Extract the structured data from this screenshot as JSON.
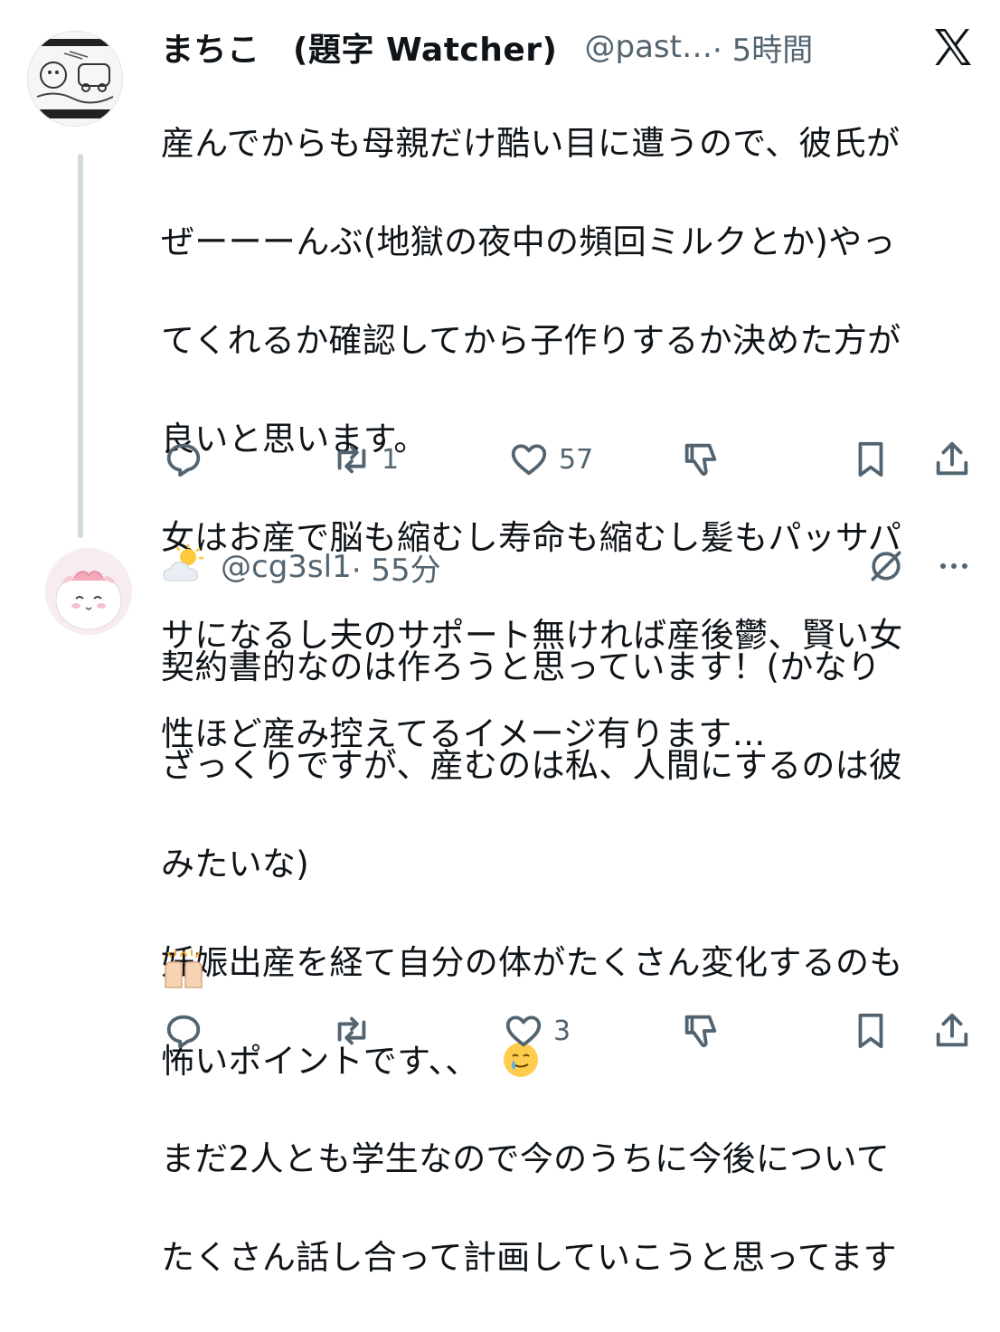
{
  "tweet1": {
    "display_name": "まちこ　(題字 Watcher)",
    "handle": "@past…",
    "time": "· 5時間",
    "body_lines": [
      "産んでからも母親だけ酷い目に遭うので、彼氏が",
      "ぜーーーんぶ(地獄の夜中の頻回ミルクとか)やっ",
      "てくれるか確認してから子作りするか決めた方が",
      "良いと思います。",
      "女はお産で脳も縮むし寿命も縮むし髪もパッサパ",
      "サになるし夫のサポート無ければ産後鬱、賢い女",
      "性ほど産み控えてるイメージ有ります…"
    ],
    "actions": {
      "retweets": "1",
      "likes": "57"
    },
    "icons": [
      "x-logo-icon",
      "reply-icon",
      "retweet-icon",
      "heart-icon",
      "dislike-icon",
      "bookmark-icon",
      "share-icon"
    ]
  },
  "tweet2": {
    "handle": "@cg3sl1",
    "time": "· 55分",
    "body_lines": [
      "契約書的なのは作ろうと思っています！(かなり",
      "ざっくりですが、産むのは私、人間にするのは彼",
      "みたいな)",
      "妊娠出産を経て自分の体がたくさん変化するのも",
      "怖いポイントです、、",
      "まだ2人とも学生なので今のうちに今後について",
      "たくさん話し合って計画していこうと思ってます"
    ],
    "actions": {
      "likes": "3"
    },
    "icons": [
      "sun-behind-cloud-icon",
      "grok-icon",
      "more-icon",
      "smiling-face-with-tear-icon",
      "raising-hands-icon"
    ]
  },
  "colors": {
    "text": "#0f1419",
    "muted": "#536471",
    "thread_line": "#cfd9de"
  }
}
